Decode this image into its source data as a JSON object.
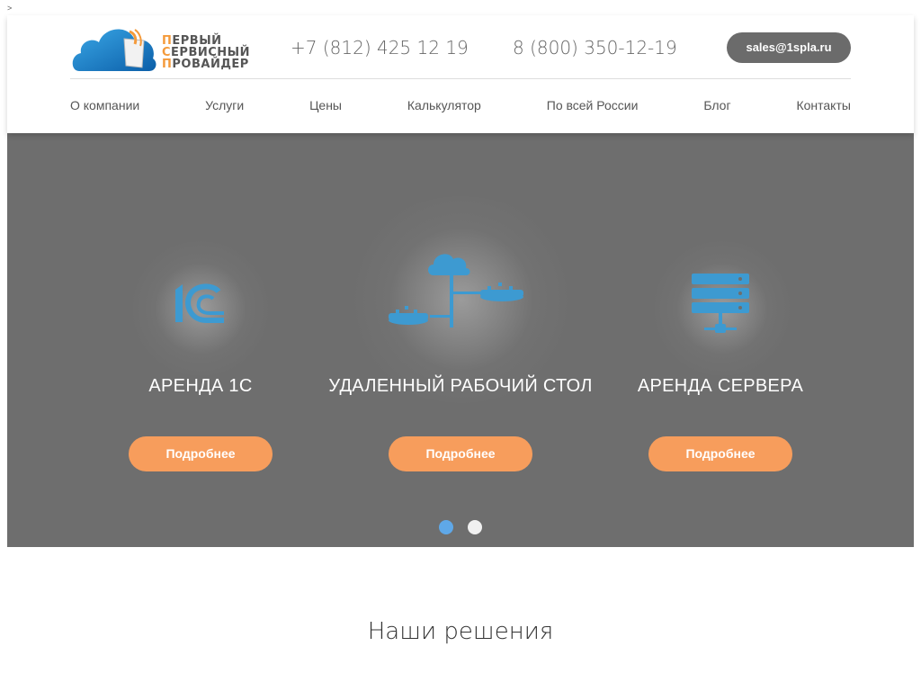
{
  "marker": ">",
  "logo": {
    "lines": [
      {
        "first": "П",
        "rest": "ЕРВЫЙ"
      },
      {
        "first": "С",
        "rest": "ЕРВИСНЫЙ"
      },
      {
        "first": "П",
        "rest": "РОВАЙДЕР"
      }
    ]
  },
  "header": {
    "phone1": "+7 (812) 425 12 19",
    "phone2": "8 (800) 350-12-19",
    "email": "sales@1spla.ru"
  },
  "nav": {
    "items": [
      "О компании",
      "Услуги",
      "Цены",
      "Калькулятор",
      "По всей России",
      "Блог",
      "Контакты"
    ]
  },
  "slider": {
    "cards": [
      {
        "title": "АРЕНДА 1С",
        "button": "Подробнее",
        "icon": "1c-logo-icon"
      },
      {
        "title": "УДАЛЕННЫЙ РАБОЧИЙ СТОЛ",
        "button": "Подробнее",
        "icon": "cloud-network-icon"
      },
      {
        "title": "АРЕНДА СЕРВЕРА",
        "button": "Подробнее",
        "icon": "server-stack-icon"
      }
    ],
    "active_dot": 0,
    "dots": 2
  },
  "colors": {
    "accent": "#f79d5c",
    "icon_blue": "#3d9ad1",
    "dot_active": "#5fa8e8",
    "dot_inactive": "#f0f0f0",
    "hero_bg": "#6e6e6e"
  },
  "section": {
    "title": "Наши решения"
  }
}
